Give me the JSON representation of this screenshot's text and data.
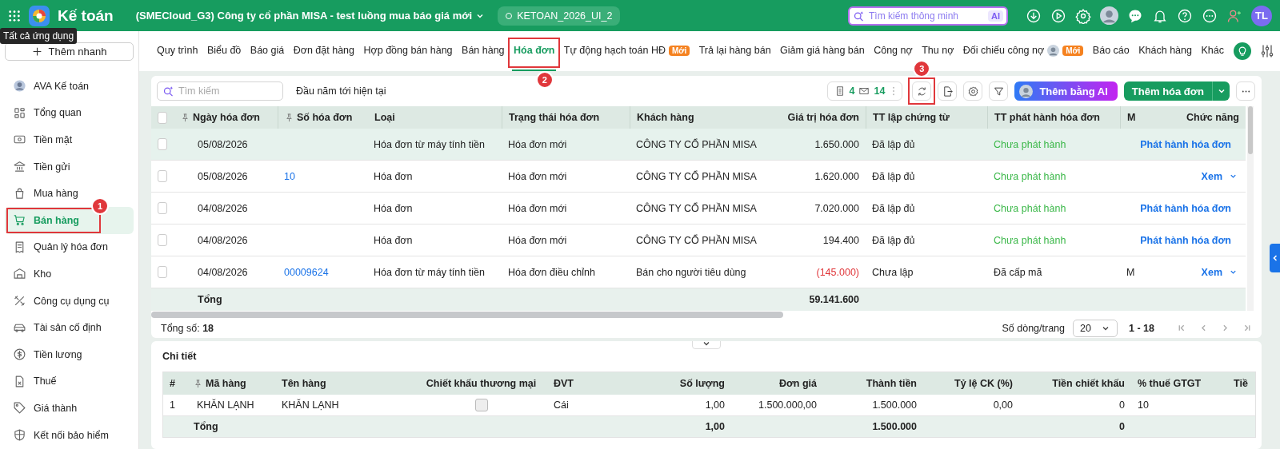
{
  "header": {
    "app_title": "Kế toán",
    "company": "(SMECloud_G3) Công ty cổ phần MISA - test luồng mua báo giá mới",
    "database": "KETOAN_2026_UI_2",
    "search_placeholder": "Tìm kiếm thông minh",
    "search_badge": "AI",
    "user_initials": "TL",
    "tooltip": "Tất cả ứng dụng"
  },
  "sidebar": {
    "quick_add": "Thêm nhanh",
    "items": [
      {
        "label": "AVA Kế toán",
        "selected": false
      },
      {
        "label": "Tổng quan",
        "selected": false
      },
      {
        "label": "Tiền mặt",
        "selected": false
      },
      {
        "label": "Tiền gửi",
        "selected": false
      },
      {
        "label": "Mua hàng",
        "selected": false
      },
      {
        "label": "Bán hàng",
        "selected": true,
        "annotation": "1"
      },
      {
        "label": "Quản lý hóa đơn",
        "selected": false
      },
      {
        "label": "Kho",
        "selected": false
      },
      {
        "label": "Công cụ dụng cụ",
        "selected": false
      },
      {
        "label": "Tài sản cố định",
        "selected": false
      },
      {
        "label": "Tiền lương",
        "selected": false
      },
      {
        "label": "Thuế",
        "selected": false
      },
      {
        "label": "Giá thành",
        "selected": false
      },
      {
        "label": "Kết nối bảo hiểm",
        "selected": false
      }
    ]
  },
  "tabs": [
    {
      "label": "Quy trình",
      "selected": false
    },
    {
      "label": "Biểu đồ",
      "selected": false
    },
    {
      "label": "Báo giá",
      "selected": false
    },
    {
      "label": "Đơn đặt hàng",
      "selected": false
    },
    {
      "label": "Hợp đồng bán hàng",
      "selected": false
    },
    {
      "label": "Bán hàng",
      "selected": false
    },
    {
      "label": "Hóa đơn",
      "selected": true,
      "annotation": "2"
    },
    {
      "label": "Tự động hạch toán HĐ",
      "selected": false,
      "badge": "Mới"
    },
    {
      "label": "Trả lại hàng bán",
      "selected": false
    },
    {
      "label": "Giảm giá hàng bán",
      "selected": false
    },
    {
      "label": "Công nợ",
      "selected": false
    },
    {
      "label": "Thu nợ",
      "selected": false
    },
    {
      "label": "Đối chiếu công nợ",
      "selected": false,
      "avatar": true,
      "badge": "Mới"
    },
    {
      "label": "Báo cáo",
      "selected": false
    },
    {
      "label": "Khách hàng",
      "selected": false
    },
    {
      "label": "Khác",
      "selected": false
    }
  ],
  "invoices": {
    "search_placeholder": "Tìm kiếm",
    "period": "Đầu năm tới hiện tại",
    "doc_count": "4",
    "mail_count": "14",
    "refresh_annotation": "3",
    "ai_button": "Thêm bằng AI",
    "add_button": "Thêm hóa đơn",
    "all_checked": false,
    "columns": [
      {
        "label": "Ngày hóa đơn",
        "pinned": true
      },
      {
        "label": "Số hóa đơn",
        "pinned": true
      },
      {
        "label": "Loại",
        "pinned": false
      },
      {
        "label": "Trạng thái hóa đơn",
        "pinned": false
      },
      {
        "label": "Khách hàng",
        "pinned": false
      },
      {
        "label": "Giá trị hóa đơn",
        "pinned": false
      },
      {
        "label": "TT lập chứng từ",
        "pinned": false
      },
      {
        "label": "TT phát hành hóa đơn",
        "pinned": false
      },
      {
        "label": "M",
        "pinned": false
      },
      {
        "label": "Chức năng",
        "pinned": false
      }
    ],
    "rows": [
      {
        "selected": true,
        "checked": false,
        "date": "05/08/2026",
        "type": "Hóa đơn từ máy tính tiền",
        "status": "Hóa đơn mới",
        "customer": "CÔNG TY CỔ PHẦN MISA",
        "value": "1.650.000",
        "negative": false,
        "doc_status": "Đã lập đủ",
        "issue_status": "Chưa phát hành",
        "issued": false,
        "action": "Phát hành hóa đơn"
      },
      {
        "selected": false,
        "checked": false,
        "date": "05/08/2026",
        "number": "10",
        "type": "Hóa đơn",
        "status": "Hóa đơn mới",
        "customer": "CÔNG TY CỔ PHẦN MISA",
        "value": "1.620.000",
        "negative": false,
        "doc_status": "Đã lập đủ",
        "issue_status": "Chưa phát hành",
        "issued": false,
        "action": "Xem"
      },
      {
        "selected": false,
        "checked": false,
        "date": "04/08/2026",
        "type": "Hóa đơn",
        "status": "Hóa đơn mới",
        "customer": "CÔNG TY CỔ PHẦN MISA",
        "value": "7.020.000",
        "negative": false,
        "doc_status": "Đã lập đủ",
        "issue_status": "Chưa phát hành",
        "issued": false,
        "action": "Phát hành hóa đơn"
      },
      {
        "selected": false,
        "checked": false,
        "date": "04/08/2026",
        "type": "Hóa đơn",
        "status": "Hóa đơn mới",
        "customer": "CÔNG TY CỔ PHẦN MISA",
        "value": "194.400",
        "negative": false,
        "doc_status": "Đã lập đủ",
        "issue_status": "Chưa phát hành",
        "issued": false,
        "action": "Phát hành hóa đơn"
      },
      {
        "selected": false,
        "checked": false,
        "date": "04/08/2026",
        "number": "00009624",
        "type": "Hóa đơn từ máy tính tiền",
        "status": "Hóa đơn điều chỉnh",
        "customer": "Bán cho người tiêu dùng",
        "value": "(145.000)",
        "negative": true,
        "doc_status": "Chưa lập",
        "issue_status": "Đã cấp mã",
        "issued": true,
        "column_9": "M",
        "action": "Xem"
      }
    ],
    "total": {
      "label": "Tổng",
      "value": "59.141.600"
    },
    "footer": {
      "count": "Tổng số: **18**",
      "page_size_label": "Số dòng/trang",
      "page_size": "20",
      "range": "1 - 18"
    }
  },
  "detail": {
    "title": "Chi tiết",
    "columns": [
      {
        "label": "#",
        "pinned": false
      },
      {
        "label": "Mã hàng",
        "pinned": true
      },
      {
        "label": "Tên hàng",
        "pinned": false
      },
      {
        "label": "Chiết khấu thương mại",
        "pinned": false
      },
      {
        "label": "ĐVT",
        "pinned": false
      },
      {
        "label": "Số lượng",
        "pinned": false
      },
      {
        "label": "Đơn giá",
        "pinned": false
      },
      {
        "label": "Thành tiền",
        "pinned": false
      },
      {
        "label": "Tỷ lệ CK (%)",
        "pinned": false
      },
      {
        "label": "Tiền chiết khấu",
        "pinned": false
      },
      {
        "label": "% thuế GTGT",
        "pinned": false
      },
      {
        "label": "Tiề",
        "pinned": false
      }
    ],
    "rows": [
      {
        "index": "1",
        "code": "KHĂN LẠNH",
        "name": "KHĂN LẠNH",
        "trade_discount": false,
        "unit": "Cái",
        "quantity": "1,00",
        "unit_price": "1.500.000,00",
        "amount": "1.500.000",
        "discount_rate": "0,00",
        "discount_amount": "0",
        "vat_rate": "10"
      }
    ],
    "total": {
      "label": "Tổng",
      "quantity": "1,00",
      "amount": "1.500.000",
      "discount_amount": "0"
    }
  }
}
